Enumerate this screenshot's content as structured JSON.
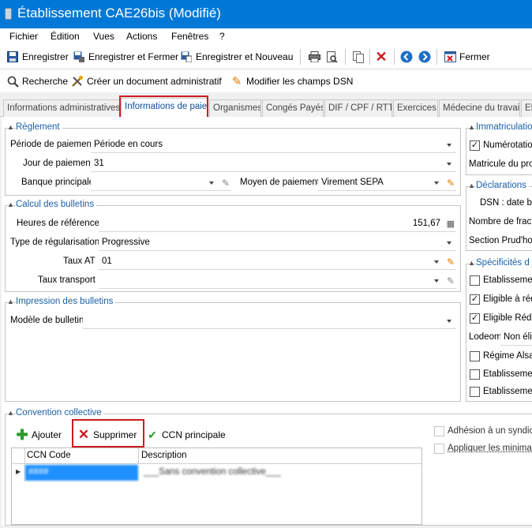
{
  "window": {
    "title": "Établissement CAE26bis (Modifié)"
  },
  "menu": [
    "Fichier",
    "Édition",
    "Vues",
    "Actions",
    "Fenêtres",
    "?"
  ],
  "toolbar1": {
    "save": "Enregistrer",
    "save_close": "Enregistrer et Fermer",
    "save_new": "Enregistrer et Nouveau",
    "close": "Fermer"
  },
  "toolbar2": {
    "search": "Recherche",
    "create_doc": "Créer un document administratif",
    "edit_dsn": "Modifier les champs DSN"
  },
  "tabs": [
    "Informations administratives",
    "Informations de paie",
    "Organismes",
    "Congés Payés",
    "DIF / CPF / RTT",
    "Exercices",
    "Médecine du travail",
    "Ef"
  ],
  "reglement": {
    "title": "Règlement",
    "periode_label": "Période de paiement",
    "periode_value": "Période en cours",
    "jour_label": "Jour de paiement",
    "jour_value": "31",
    "banque_label": "Banque principale",
    "banque_value": "",
    "moyen_label": "Moyen de paiement",
    "moyen_value": "Virement SEPA"
  },
  "calcul": {
    "title": "Calcul des bulletins",
    "heures_label": "Heures de référence",
    "heures_value": "151,67",
    "type_label": "Type de régularisation",
    "type_value": "Progressive",
    "taux_at_label": "Taux AT",
    "taux_at_value": "01",
    "taux_transport_label": "Taux transport",
    "taux_transport_value": ""
  },
  "impression": {
    "title": "Impression des bulletins",
    "modele_label": "Modèle de bulletin",
    "modele_value": ""
  },
  "right": {
    "immat_title": "Immatriculatio",
    "numerotation": "Numérotation",
    "matricule": "Matricule du proc",
    "decl_title": "Déclarations",
    "dsn_date": "DSN : date bu",
    "nombre_frac": "Nombre de fracti",
    "section_prud": "Section Prud'hom",
    "spec_title": "Spécificités d",
    "etab1": "Etablissemen",
    "eligible1": "Eligible à rédu",
    "eligible2": "Eligible Réduc",
    "lodeom_label": "Lodeom",
    "lodeom_value": "Non élig",
    "regime": "Régime Alsac",
    "etab2": "Etablissemen",
    "etab3": "Etablissemen"
  },
  "convention": {
    "title": "Convention collective",
    "add": "Ajouter",
    "delete": "Supprimer",
    "ccn_principale": "CCN principale",
    "columns": [
      "CCN Code",
      "Description"
    ],
    "rows": [
      {
        "code": "####",
        "description": "___Sans convention collective___"
      }
    ],
    "adhesion": "Adhésion à un syndica",
    "appliquer": "Appliquer les minima co"
  },
  "colors": {
    "titlebar": "#0078d7",
    "group_title": "#1a5fa8",
    "highlight": "#d0191f",
    "selected_row": "#1e90ff"
  }
}
